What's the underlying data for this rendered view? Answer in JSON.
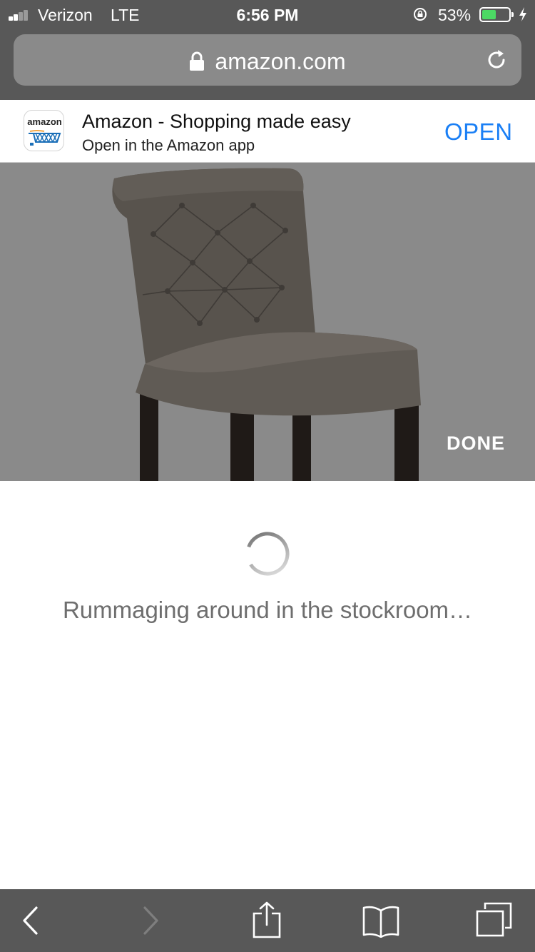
{
  "status_bar": {
    "carrier": "Verizon",
    "network": "LTE",
    "time": "6:56 PM",
    "battery_percent": "53%",
    "battery_level": 0.53,
    "signal_bars_filled": 2,
    "icons": [
      "signal-icon",
      "rotation-lock-icon",
      "battery-icon",
      "charging-bolt-icon"
    ]
  },
  "browser": {
    "url": "amazon.com",
    "icons": [
      "lock-icon",
      "reload-icon"
    ]
  },
  "app_banner": {
    "title": "Amazon - Shopping made easy",
    "subtitle": "Open in the Amazon app",
    "open_label": "OPEN",
    "icon_wordmark": "amazon",
    "colors": {
      "open": "#1a7ff5"
    }
  },
  "viewer": {
    "done_label": "DONE",
    "image_subject": "tufted-dining-chair"
  },
  "loading": {
    "message": "Rummaging around in the stockroom…"
  },
  "toolbar": {
    "icons": [
      "back-icon",
      "forward-icon",
      "share-icon",
      "bookmarks-icon",
      "tabs-icon"
    ],
    "forward_enabled": false
  },
  "colors": {
    "chrome": "#585858",
    "url_field": "#8a8a8a",
    "viewer_bg": "#8a8a8a",
    "battery_fill": "#4cd964"
  }
}
